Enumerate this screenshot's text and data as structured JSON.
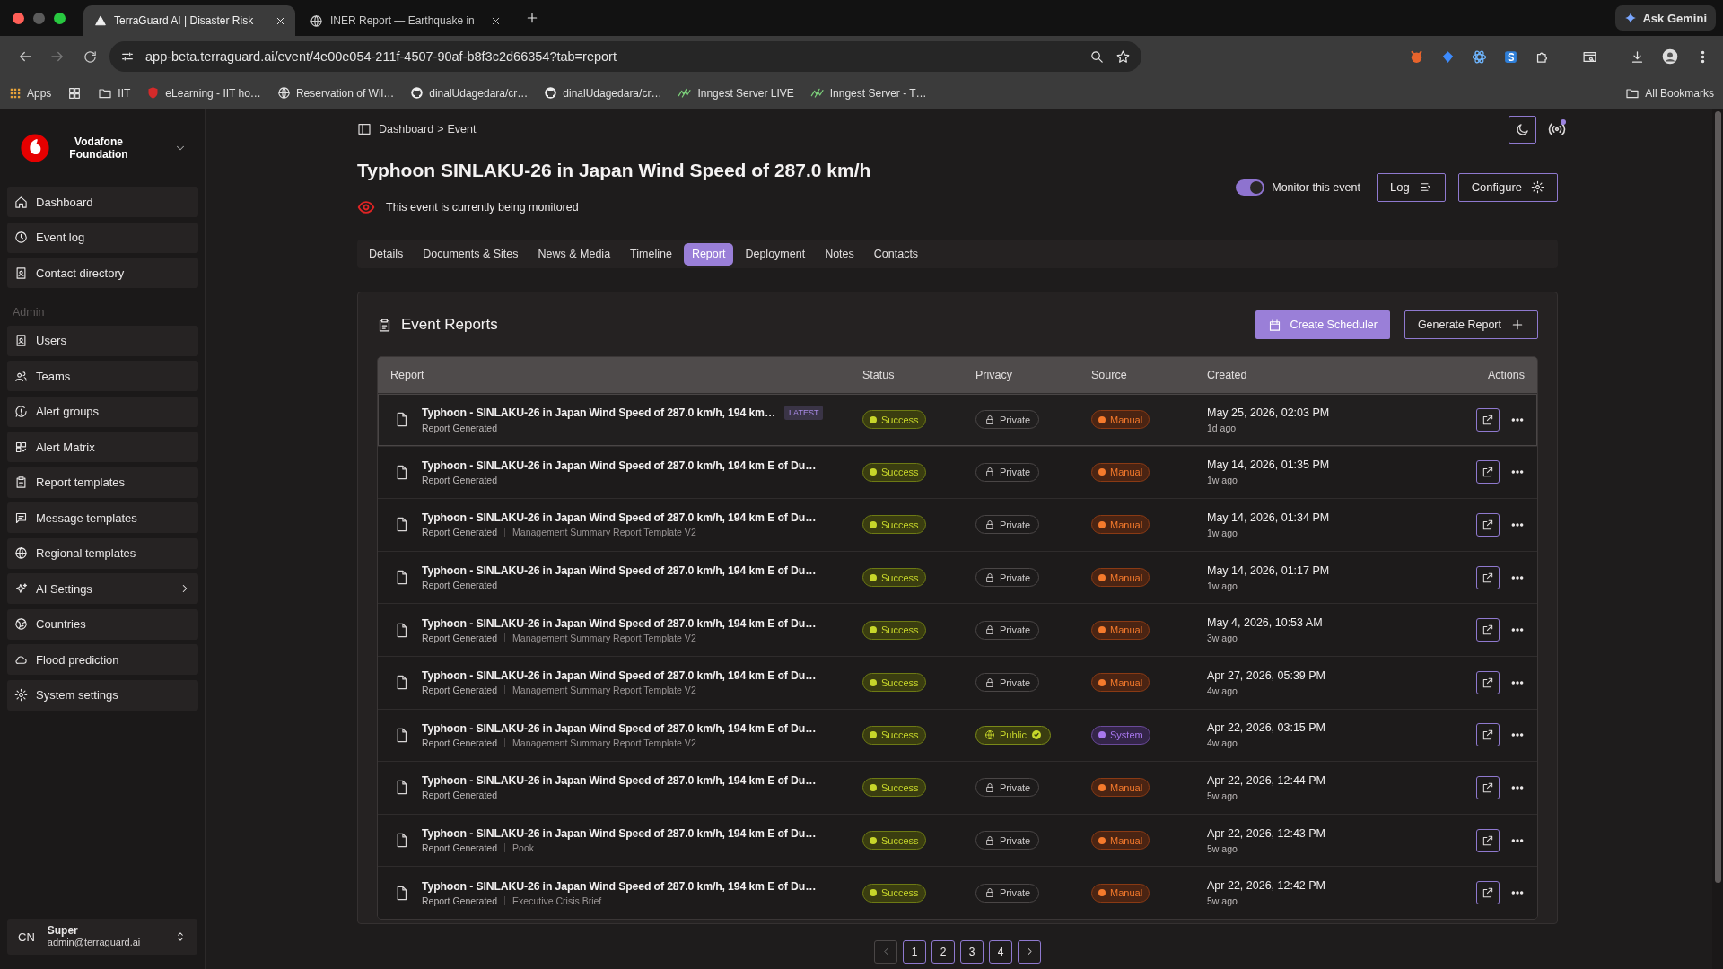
{
  "browser": {
    "tabs": [
      {
        "title": "TerraGuard AI | Disaster Risk",
        "selected": true
      },
      {
        "title": "INER Report — Earthquake in",
        "selected": false
      }
    ],
    "gemini_button": "Ask Gemini",
    "address": "app-beta.terraguard.ai/event/4e00e054-211f-4507-90af-b8f3c2d66354?tab=report",
    "bookmarks": [
      {
        "label": "Apps",
        "kind": "apps"
      },
      {
        "kind": "groups"
      },
      {
        "label": "IIT",
        "kind": "folder"
      },
      {
        "label": "eLearning - IIT ho…",
        "kind": "shield"
      },
      {
        "label": "Reservation of Wil…",
        "kind": "globe"
      },
      {
        "label": "dinalUdagedara/cr…",
        "kind": "github"
      },
      {
        "label": "dinalUdagedara/cr…",
        "kind": "github"
      },
      {
        "label": "Inngest Server LIVE",
        "kind": "wave"
      },
      {
        "label": "Inngest Server - T…",
        "kind": "wave"
      }
    ],
    "all_bookmarks": "All Bookmarks"
  },
  "sidebar": {
    "org": "Vodafone Foundation",
    "groups": [
      {
        "items": [
          {
            "label": "Dashboard",
            "submenu": false
          },
          {
            "label": "Event log",
            "submenu": false
          },
          {
            "label": "Contact directory",
            "submenu": false
          }
        ]
      },
      {
        "title": "Admin",
        "items": [
          {
            "label": "Users",
            "submenu": false
          },
          {
            "label": "Teams",
            "submenu": false
          },
          {
            "label": "Alert groups",
            "submenu": false
          },
          {
            "label": "Alert Matrix",
            "submenu": false
          },
          {
            "label": "Report templates",
            "submenu": false
          },
          {
            "label": "Message templates",
            "submenu": false
          },
          {
            "label": "Regional templates",
            "submenu": false
          },
          {
            "label": "AI Settings",
            "submenu": true
          },
          {
            "label": "Countries",
            "submenu": false
          },
          {
            "label": "Flood prediction",
            "submenu": false
          },
          {
            "label": "System settings",
            "submenu": false
          }
        ]
      }
    ],
    "user": {
      "initials": "CN",
      "name": "Super",
      "email": "admin@terraguard.ai"
    }
  },
  "breadcrumb": {
    "items": [
      "Dashboard",
      "Event"
    ],
    "separator": ">"
  },
  "event": {
    "title": "Typhoon SINLAKU-26 in Japan Wind Speed of 287.0 km/h",
    "monitoring_note": "This event is currently being monitored",
    "monitor_toggle": {
      "label": "Monitor this event",
      "on": true
    },
    "buttons": [
      {
        "label": "Log",
        "kind": "log"
      },
      {
        "label": "Configure",
        "kind": "configure"
      }
    ]
  },
  "tabs": [
    {
      "label": "Details",
      "selected": false
    },
    {
      "label": "Documents & Sites",
      "selected": false
    },
    {
      "label": "News & Media",
      "selected": false
    },
    {
      "label": "Timeline",
      "selected": false
    },
    {
      "label": "Report",
      "selected": true
    },
    {
      "label": "Deployment",
      "selected": false
    },
    {
      "label": "Notes",
      "selected": false
    },
    {
      "label": "Contacts",
      "selected": false
    }
  ],
  "reports": {
    "title": "Event Reports",
    "buttons": [
      {
        "label": "Create Scheduler",
        "kind": "primary"
      },
      {
        "label": "Generate Report",
        "kind": "outline"
      }
    ],
    "columns": [
      "Report",
      "Status",
      "Privacy",
      "Source",
      "Created",
      "Actions"
    ],
    "rows": [
      {
        "title": "Typhoon - SINLAKU-26 in Japan Wind Speed of 287.0 km/h, 194 km…",
        "badge": "LATEST",
        "detail": "Report Generated",
        "status": {
          "label": "Success",
          "kind": "success"
        },
        "privacy": {
          "label": "Private",
          "kind": "private"
        },
        "source": {
          "label": "Manual",
          "kind": "manual"
        },
        "created": "May 25, 2026, 02:03 PM",
        "ago": "1d ago"
      },
      {
        "title": "Typhoon - SINLAKU-26 in Japan Wind Speed of 287.0 km/h, 194 km E of Du…",
        "detail": "Report Generated",
        "status": {
          "label": "Success",
          "kind": "success"
        },
        "privacy": {
          "label": "Private",
          "kind": "private"
        },
        "source": {
          "label": "Manual",
          "kind": "manual"
        },
        "created": "May 14, 2026, 01:35 PM",
        "ago": "1w ago"
      },
      {
        "title": "Typhoon - SINLAKU-26 in Japan Wind Speed of 287.0 km/h, 194 km E of Du…",
        "detail": "Report Generated",
        "template": "Management Summary Report Template V2",
        "status": {
          "label": "Success",
          "kind": "success"
        },
        "privacy": {
          "label": "Private",
          "kind": "private"
        },
        "source": {
          "label": "Manual",
          "kind": "manual"
        },
        "created": "May 14, 2026, 01:34 PM",
        "ago": "1w ago"
      },
      {
        "title": "Typhoon - SINLAKU-26 in Japan Wind Speed of 287.0 km/h, 194 km E of Du…",
        "detail": "Report Generated",
        "status": {
          "label": "Success",
          "kind": "success"
        },
        "privacy": {
          "label": "Private",
          "kind": "private"
        },
        "source": {
          "label": "Manual",
          "kind": "manual"
        },
        "created": "May 14, 2026, 01:17 PM",
        "ago": "1w ago"
      },
      {
        "title": "Typhoon - SINLAKU-26 in Japan Wind Speed of 287.0 km/h, 194 km E of Du…",
        "detail": "Report Generated",
        "template": "Management Summary Report Template V2",
        "status": {
          "label": "Success",
          "kind": "success"
        },
        "privacy": {
          "label": "Private",
          "kind": "private"
        },
        "source": {
          "label": "Manual",
          "kind": "manual"
        },
        "created": "May 4, 2026, 10:53 AM",
        "ago": "3w ago"
      },
      {
        "title": "Typhoon - SINLAKU-26 in Japan Wind Speed of 287.0 km/h, 194 km E of Du…",
        "detail": "Report Generated",
        "template": "Management Summary Report Template V2",
        "status": {
          "label": "Success",
          "kind": "success"
        },
        "privacy": {
          "label": "Private",
          "kind": "private"
        },
        "source": {
          "label": "Manual",
          "kind": "manual"
        },
        "created": "Apr 27, 2026, 05:39 PM",
        "ago": "4w ago"
      },
      {
        "title": "Typhoon - SINLAKU-26 in Japan Wind Speed of 287.0 km/h, 194 km E of Du…",
        "detail": "Report Generated",
        "template": "Management Summary Report Template V2",
        "status": {
          "label": "Success",
          "kind": "success"
        },
        "privacy": {
          "label": "Public",
          "kind": "public"
        },
        "source": {
          "label": "System",
          "kind": "system"
        },
        "created": "Apr 22, 2026, 03:15 PM",
        "ago": "4w ago"
      },
      {
        "title": "Typhoon - SINLAKU-26 in Japan Wind Speed of 287.0 km/h, 194 km E of Du…",
        "detail": "Report Generated",
        "status": {
          "label": "Success",
          "kind": "success"
        },
        "privacy": {
          "label": "Private",
          "kind": "private"
        },
        "source": {
          "label": "Manual",
          "kind": "manual"
        },
        "created": "Apr 22, 2026, 12:44 PM",
        "ago": "5w ago"
      },
      {
        "title": "Typhoon - SINLAKU-26 in Japan Wind Speed of 287.0 km/h, 194 km E of Du…",
        "detail": "Report Generated",
        "template": "Pook",
        "status": {
          "label": "Success",
          "kind": "success"
        },
        "privacy": {
          "label": "Private",
          "kind": "private"
        },
        "source": {
          "label": "Manual",
          "kind": "manual"
        },
        "created": "Apr 22, 2026, 12:43 PM",
        "ago": "5w ago"
      },
      {
        "title": "Typhoon - SINLAKU-26 in Japan Wind Speed of 287.0 km/h, 194 km E of Du…",
        "detail": "Report Generated",
        "template": "Executive Crisis Brief",
        "status": {
          "label": "Success",
          "kind": "success"
        },
        "privacy": {
          "label": "Private",
          "kind": "private"
        },
        "source": {
          "label": "Manual",
          "kind": "manual"
        },
        "created": "Apr 22, 2026, 12:42 PM",
        "ago": "5w ago"
      }
    ],
    "pagination": {
      "prev_disabled": true,
      "pages": [
        "1",
        "2",
        "3",
        "4"
      ],
      "next_disabled": false
    }
  }
}
